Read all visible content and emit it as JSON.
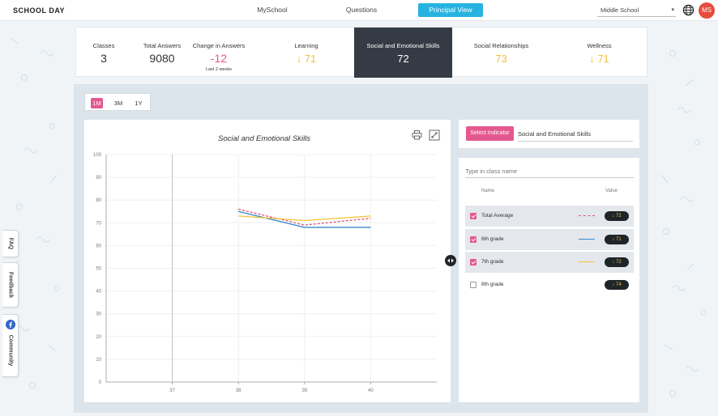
{
  "app": {
    "logo": "SCHOOL DAY"
  },
  "nav": [
    {
      "label": "MySchool"
    },
    {
      "label": "Questions"
    },
    {
      "label": "Principal View"
    }
  ],
  "school_select": {
    "value": "Middle School",
    "caret": "▾"
  },
  "user": {
    "initials": "MS"
  },
  "stats": {
    "classes": {
      "label": "Classes",
      "value": "3"
    },
    "total_answers": {
      "label": "Total Answers",
      "value": "9080"
    },
    "change": {
      "label": "Change in Answers",
      "value": "-12",
      "note": "Last 2 weeks"
    }
  },
  "categories": [
    {
      "label": "Learning",
      "value": "71",
      "arrow": "↓"
    },
    {
      "label": "Social and Emotional Skills",
      "value": "72",
      "arrow": ""
    },
    {
      "label": "Social Relationships",
      "value": "73",
      "arrow": ""
    },
    {
      "label": "Wellness",
      "value": "71",
      "arrow": "↓"
    }
  ],
  "ranges": [
    {
      "label": "1M"
    },
    {
      "label": "3M"
    },
    {
      "label": "1Y"
    }
  ],
  "indicator": {
    "button": "Select Indicator",
    "value": "Social and Emotional Skills"
  },
  "class_search": {
    "placeholder": "Type in class name"
  },
  "legend_header": {
    "name": "Name",
    "value": "Value"
  },
  "legend": [
    {
      "name": "Total Average",
      "value": "↓ 72",
      "checked": true,
      "color": "#e0527f",
      "dash": "dashed"
    },
    {
      "name": "6th grade",
      "value": "↓ 71",
      "checked": true,
      "color": "#3a86d0",
      "dash": "solid"
    },
    {
      "name": "7th grade",
      "value": "↓ 72",
      "checked": true,
      "color": "#f5c332",
      "dash": "solid"
    },
    {
      "name": "8th grade",
      "value": "↓ 74",
      "checked": false,
      "color": "",
      "dash": ""
    }
  ],
  "side_tabs": [
    {
      "label": "FAQ"
    },
    {
      "label": "Feedback"
    },
    {
      "label": "Community"
    }
  ],
  "colors": {
    "accent_pink": "#e45890",
    "accent_blue": "#27b3e0",
    "dark": "#343b44",
    "down_arrow": "#f5c332"
  },
  "chart_data": {
    "type": "line",
    "title": "Social and Emotional Skills",
    "x": [
      37,
      38,
      39,
      40
    ],
    "ylim": [
      0,
      100
    ],
    "yticks": [
      0,
      10,
      20,
      30,
      40,
      50,
      60,
      70,
      80,
      90,
      100
    ],
    "grid": true,
    "series": [
      {
        "name": "Total Average",
        "x": [
          38,
          39,
          40
        ],
        "values": [
          76,
          69,
          72
        ],
        "color": "#e0527f",
        "dash": "dashed"
      },
      {
        "name": "6th grade",
        "x": [
          38,
          39,
          40
        ],
        "values": [
          75,
          68,
          68
        ],
        "color": "#3a86d0",
        "dash": "solid"
      },
      {
        "name": "7th grade",
        "x": [
          38,
          39,
          40
        ],
        "values": [
          73,
          71,
          73
        ],
        "color": "#f5c332",
        "dash": "solid"
      }
    ]
  }
}
